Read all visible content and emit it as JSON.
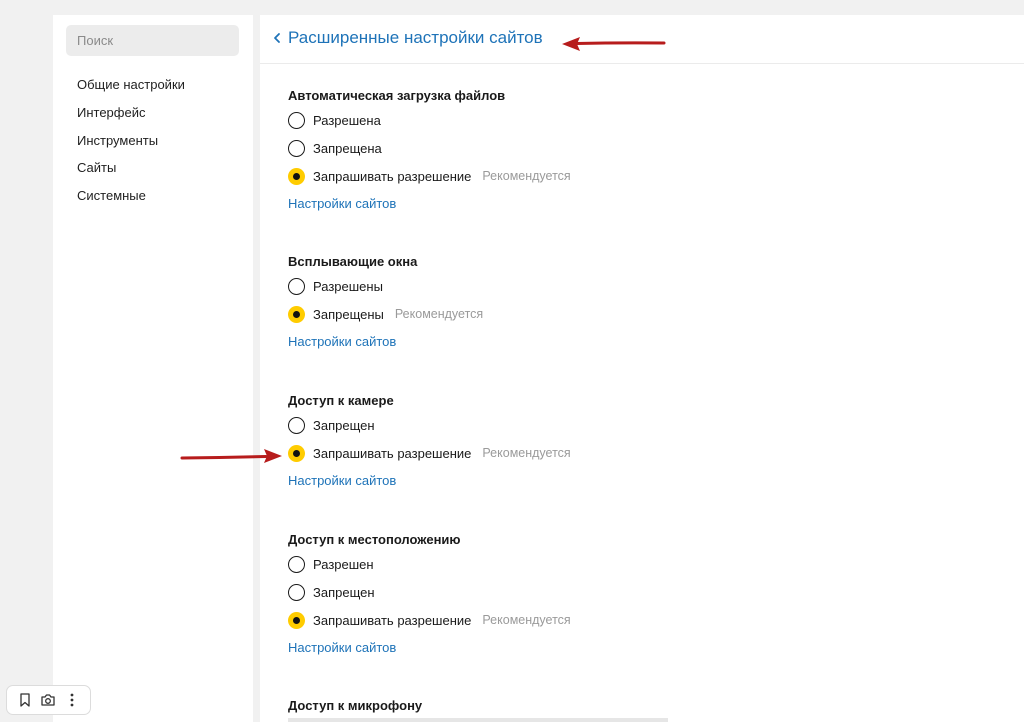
{
  "sidebar": {
    "search_placeholder": "Поиск",
    "items": [
      {
        "label": "Общие настройки"
      },
      {
        "label": "Интерфейс"
      },
      {
        "label": "Инструменты"
      },
      {
        "label": "Сайты"
      },
      {
        "label": "Системные"
      }
    ]
  },
  "header": {
    "title": "Расширенные настройки сайтов"
  },
  "sections": [
    {
      "title": "Автоматическая загрузка файлов",
      "options": [
        {
          "label": "Разрешена",
          "note": "",
          "selected": false
        },
        {
          "label": "Запрещена",
          "note": "",
          "selected": false
        },
        {
          "label": "Запрашивать разрешение",
          "note": "Рекомендуется",
          "selected": true
        }
      ],
      "link": "Настройки сайтов"
    },
    {
      "title": "Всплывающие окна",
      "options": [
        {
          "label": "Разрешены",
          "note": "",
          "selected": false
        },
        {
          "label": "Запрещены",
          "note": "Рекомендуется",
          "selected": true
        }
      ],
      "link": "Настройки сайтов"
    },
    {
      "title": "Доступ к камере",
      "options": [
        {
          "label": "Запрещен",
          "note": "",
          "selected": false
        },
        {
          "label": "Запрашивать разрешение",
          "note": "Рекомендуется",
          "selected": true
        }
      ],
      "link": "Настройки сайтов"
    },
    {
      "title": "Доступ к местоположению",
      "options": [
        {
          "label": "Разрешен",
          "note": "",
          "selected": false
        },
        {
          "label": "Запрещен",
          "note": "",
          "selected": false
        },
        {
          "label": "Запрашивать разрешение",
          "note": "Рекомендуется",
          "selected": true
        }
      ],
      "link": "Настройки сайтов"
    },
    {
      "title": "Доступ к микрофону",
      "options": [],
      "link": ""
    }
  ],
  "mini_toolbar": {
    "icons": [
      "bookmark-icon",
      "screenshot-icon",
      "more-vertical-icon"
    ]
  },
  "colors": {
    "accent_link": "#1e73b8",
    "radio_selected": "#ffcc00",
    "annotation_arrow": "#b71c1c"
  }
}
